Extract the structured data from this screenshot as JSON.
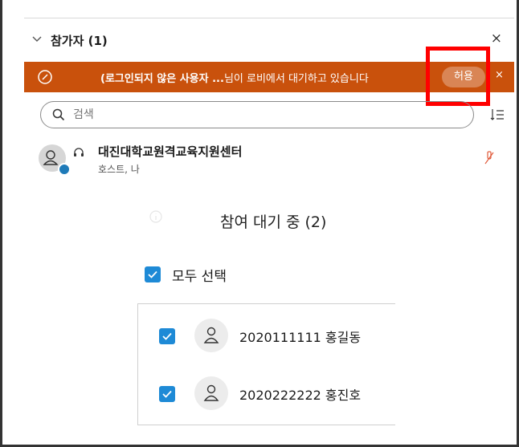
{
  "participants_header": {
    "title": "참가자 (1)",
    "close_label": "×"
  },
  "lobby_banner": {
    "bold_text": "(로그인되지 않은 사용자 ...",
    "text": "님이 로비에서 대기하고 있습니다",
    "allow_label": "허용",
    "close_label": "×",
    "color": "#c9510c"
  },
  "search": {
    "value": "",
    "placeholder": "검색"
  },
  "host": {
    "name": "대진대학교원격교육지원센터",
    "role": "호스트, 나"
  },
  "waiting": {
    "title": "참여 대기 중 (2)",
    "select_all_label": "모두 선택",
    "participants": [
      {
        "name": "2020111111 홍길동",
        "checked": true
      },
      {
        "name": "2020222222 홍진호",
        "checked": true
      }
    ]
  },
  "colors": {
    "accent": "#1e8ad6",
    "highlight": "#ff0000",
    "muted_mic": "#e05a3a"
  }
}
